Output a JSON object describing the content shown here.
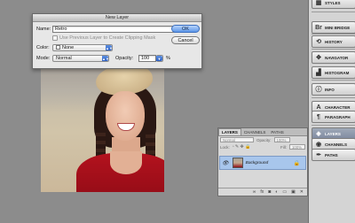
{
  "dialog": {
    "title": "New Layer",
    "name_label": "Name:",
    "name_value": "Retro",
    "clipping_mask_label": "Use Previous Layer to Create Clipping Mask",
    "color_label": "Color:",
    "color_value": "None",
    "mode_label": "Mode:",
    "mode_value": "Normal",
    "opacity_label": "Opacity:",
    "opacity_value": "100",
    "opacity_unit": "%",
    "ok_label": "OK",
    "cancel_label": "Cancel"
  },
  "panels": [
    {
      "label": "STYLES",
      "icon": "styles-icon",
      "glyph": "▦"
    },
    {
      "label": "MINI BRIDGE",
      "icon": "bridge-icon",
      "glyph": "Br"
    },
    {
      "label": "HISTORY",
      "icon": "history-icon",
      "glyph": "⟲"
    },
    {
      "label": "NAVIGATOR",
      "icon": "navigator-icon",
      "glyph": "✥"
    },
    {
      "label": "HISTOGRAM",
      "icon": "histogram-icon",
      "glyph": "▟"
    },
    {
      "label": "INFO",
      "icon": "info-icon",
      "glyph": "ⓘ"
    },
    {
      "label": "CHARACTER",
      "icon": "character-icon",
      "glyph": "A"
    },
    {
      "label": "PARAGRAPH",
      "icon": "paragraph-icon",
      "glyph": "¶"
    },
    {
      "label": "LAYERS",
      "icon": "layers-icon",
      "glyph": "◈",
      "active": true
    },
    {
      "label": "CHANNELS",
      "icon": "channels-icon",
      "glyph": "◉"
    },
    {
      "label": "PATHS",
      "icon": "paths-icon",
      "glyph": "✒"
    }
  ],
  "layers_panel": {
    "tabs": [
      "LAYERS",
      "CHANNELS",
      "PATHS"
    ],
    "blend_mode": "Normal",
    "opacity_label": "Opacity:",
    "opacity_value": "100%",
    "lock_label": "Lock:",
    "fill_label": "Fill:",
    "fill_value": "100%",
    "layer_name": "Background",
    "footer_icons": [
      "link-icon",
      "fx-icon",
      "mask-icon",
      "adjustment-icon",
      "folder-icon",
      "new-layer-icon",
      "trash-icon"
    ]
  },
  "colors": {
    "canvas_bg": "#8c8c8c",
    "selected_layer": "#a8c6ec",
    "ok_button": "#5e97e8"
  }
}
